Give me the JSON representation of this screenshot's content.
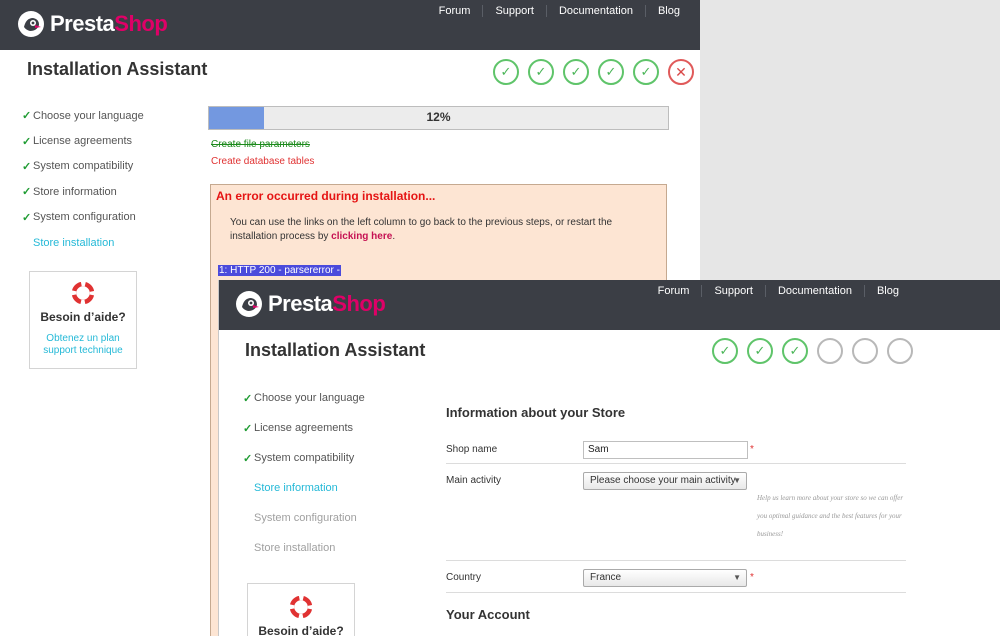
{
  "window1": {
    "logo": {
      "part1": "Presta",
      "part2": "Shop"
    },
    "nav": [
      "Forum",
      "Support",
      "Documentation",
      "Blog"
    ],
    "title": "Installation Assistant",
    "steps": [
      "ok",
      "ok",
      "ok",
      "ok",
      "ok",
      "error"
    ],
    "sidebar": [
      {
        "label": "Choose your language",
        "done": true
      },
      {
        "label": "License agreements",
        "done": true
      },
      {
        "label": "System compatibility",
        "done": true
      },
      {
        "label": "Store information",
        "done": true
      },
      {
        "label": "System configuration",
        "done": true
      },
      {
        "label": "Store installation",
        "done": false
      }
    ],
    "help": {
      "title": "Besoin d’aide?",
      "link": "Obtenez un plan support technique"
    },
    "progress": {
      "value": 12,
      "label": "12%"
    },
    "tasks": [
      {
        "label": "Create file parameters",
        "status": "done"
      },
      {
        "label": "Create database tables",
        "status": "failed"
      }
    ],
    "error": {
      "title": "An error occurred during installation...",
      "text": "You can use the links on the left column to go back to the previous steps, or restart the installation process by",
      "link": "clicking here",
      "detail": "1: HTTP 200 - parsererror -"
    }
  },
  "window2": {
    "logo": {
      "part1": "Presta",
      "part2": "Shop"
    },
    "nav": [
      "Forum",
      "Support",
      "Documentation",
      "Blog"
    ],
    "title": "Installation Assistant",
    "steps": [
      "ok",
      "ok",
      "ok",
      "todo",
      "todo",
      "todo"
    ],
    "sidebar": [
      {
        "label": "Choose your language",
        "state": "done"
      },
      {
        "label": "License agreements",
        "state": "done"
      },
      {
        "label": "System compatibility",
        "state": "done"
      },
      {
        "label": "Store information",
        "state": "current"
      },
      {
        "label": "System configuration",
        "state": "disabled"
      },
      {
        "label": "Store installation",
        "state": "disabled"
      }
    ],
    "help": {
      "title": "Besoin d’aide?"
    },
    "form": {
      "section1": "Information about your Store",
      "shop_name_label": "Shop name",
      "shop_name_value": "Sam",
      "main_activity_label": "Main activity",
      "main_activity_value": "Please choose your main activity",
      "hint": "Help us learn more about your store so we can offer you optimal guidance and the best features for your business!",
      "country_label": "Country",
      "country_value": "France",
      "required_mark": "*",
      "section2": "Your Account"
    }
  },
  "colors": {
    "topbar": "#3b3e45",
    "accent": "#25b9d7",
    "brand": "#df0067",
    "ok": "#5fc46a",
    "error": "#e05a5a"
  }
}
